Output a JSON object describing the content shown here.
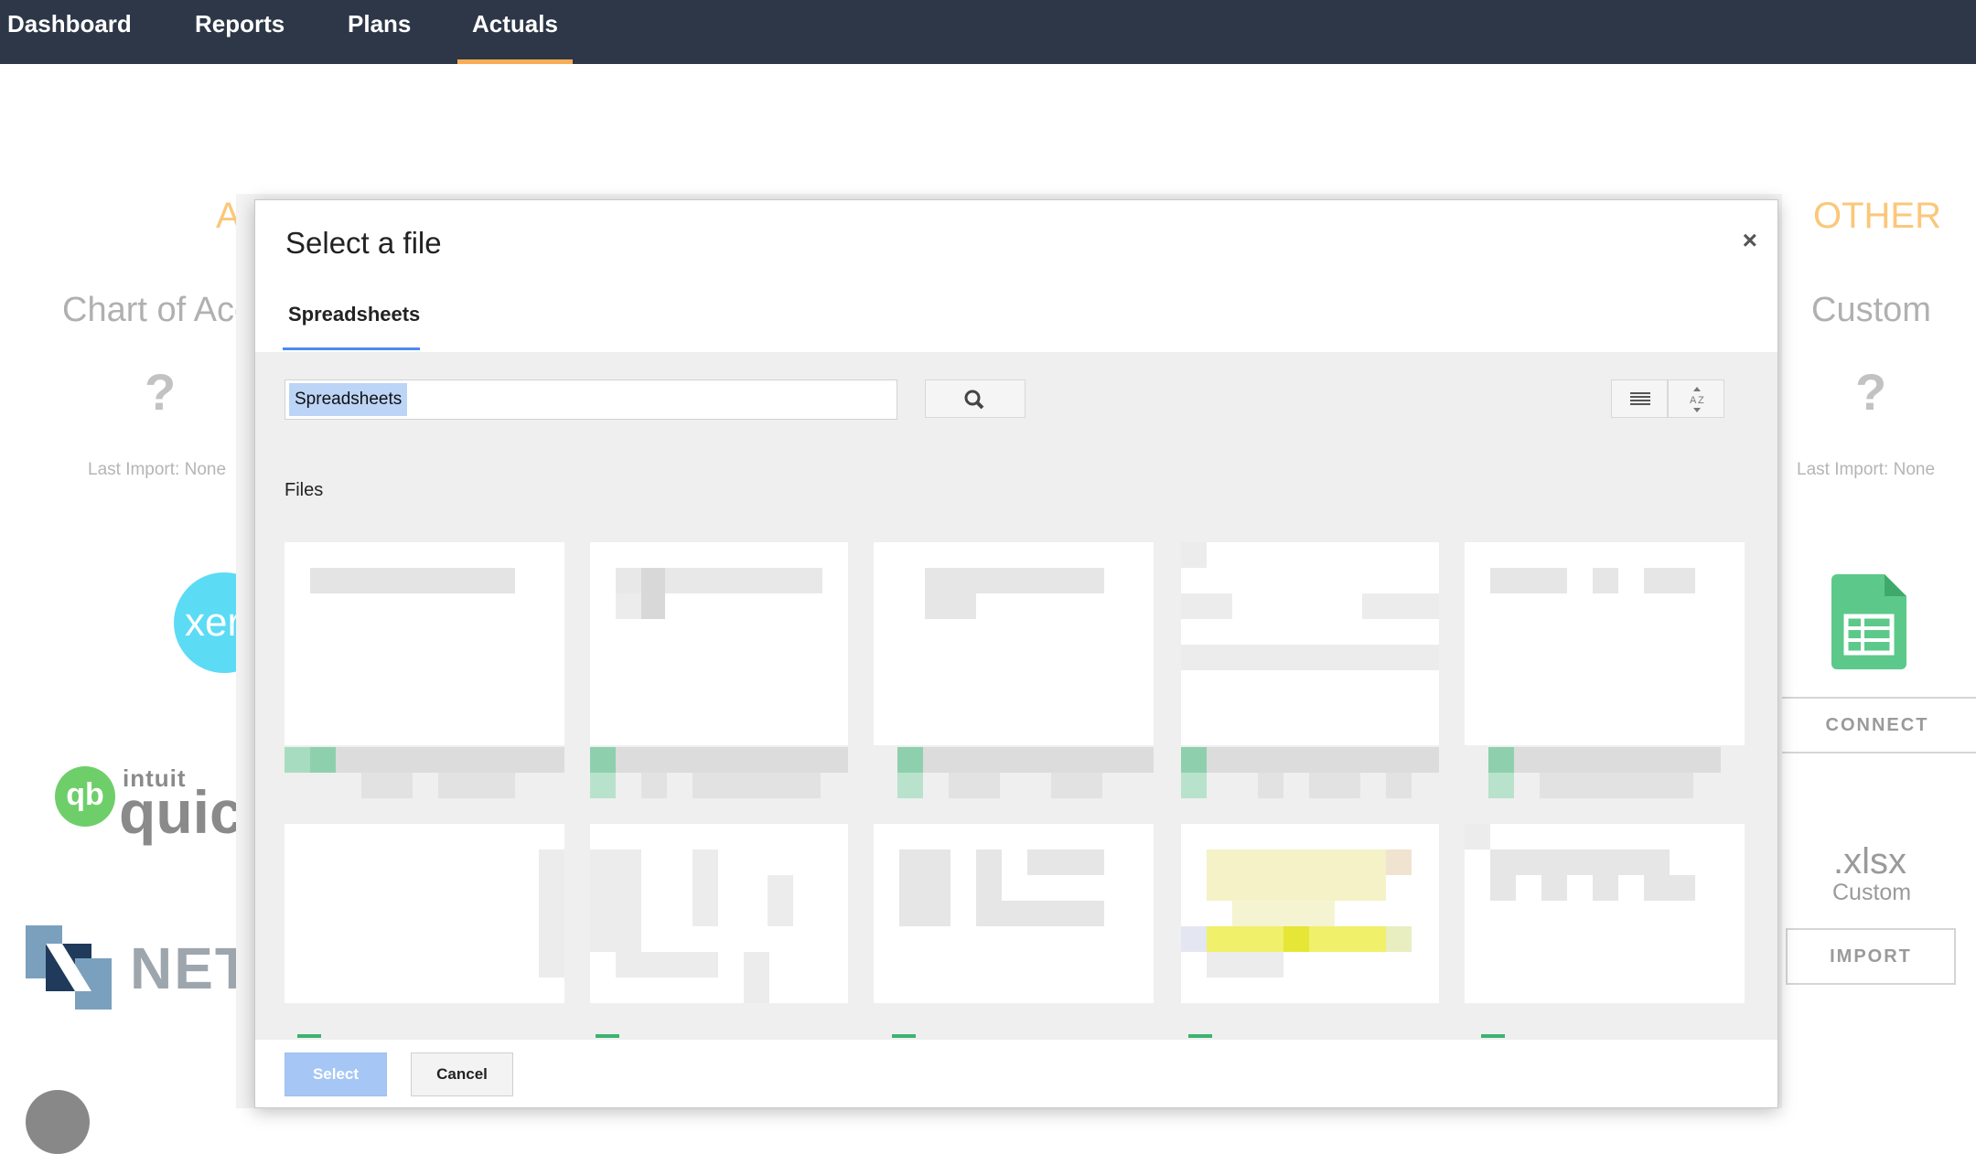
{
  "nav": {
    "items": [
      {
        "label": "Dashboard"
      },
      {
        "label": "Reports"
      },
      {
        "label": "Plans"
      },
      {
        "label": "Actuals"
      }
    ],
    "active": "Actuals",
    "accent": "#f6ad55",
    "background": "#2d3748"
  },
  "background_page": {
    "left_section": {
      "title": "AC",
      "column_title": "Chart of Acct",
      "status_icon": "?",
      "last_import": "Last Import: None",
      "integrations": [
        {
          "name": "xero",
          "text": "xero"
        },
        {
          "name": "quickbooks",
          "small_text": "intuit",
          "text": "quickl"
        },
        {
          "name": "netsuite",
          "text": "NETS"
        }
      ]
    },
    "right_section": {
      "title": "OTHER",
      "column_title": "Custom",
      "status_icon": "?",
      "last_import": "Last Import: None",
      "sheets_icon": "google-sheets-icon",
      "connect_label": "CONNECT",
      "xlsx_label": ".xlsx",
      "xlsx_sublabel": "Custom",
      "import_label": "IMPORT"
    }
  },
  "modal": {
    "title": "Select a file",
    "close_label": "×",
    "tab_label": "Spreadsheets",
    "search": {
      "value": "Spreadsheets",
      "icon": "search-icon"
    },
    "view_buttons": [
      {
        "icon": "list-view-icon"
      },
      {
        "icon": "sort-az-icon"
      }
    ],
    "files_label": "Files",
    "select_label": "Select",
    "cancel_label": "Cancel",
    "accent": "#4a8af4"
  }
}
